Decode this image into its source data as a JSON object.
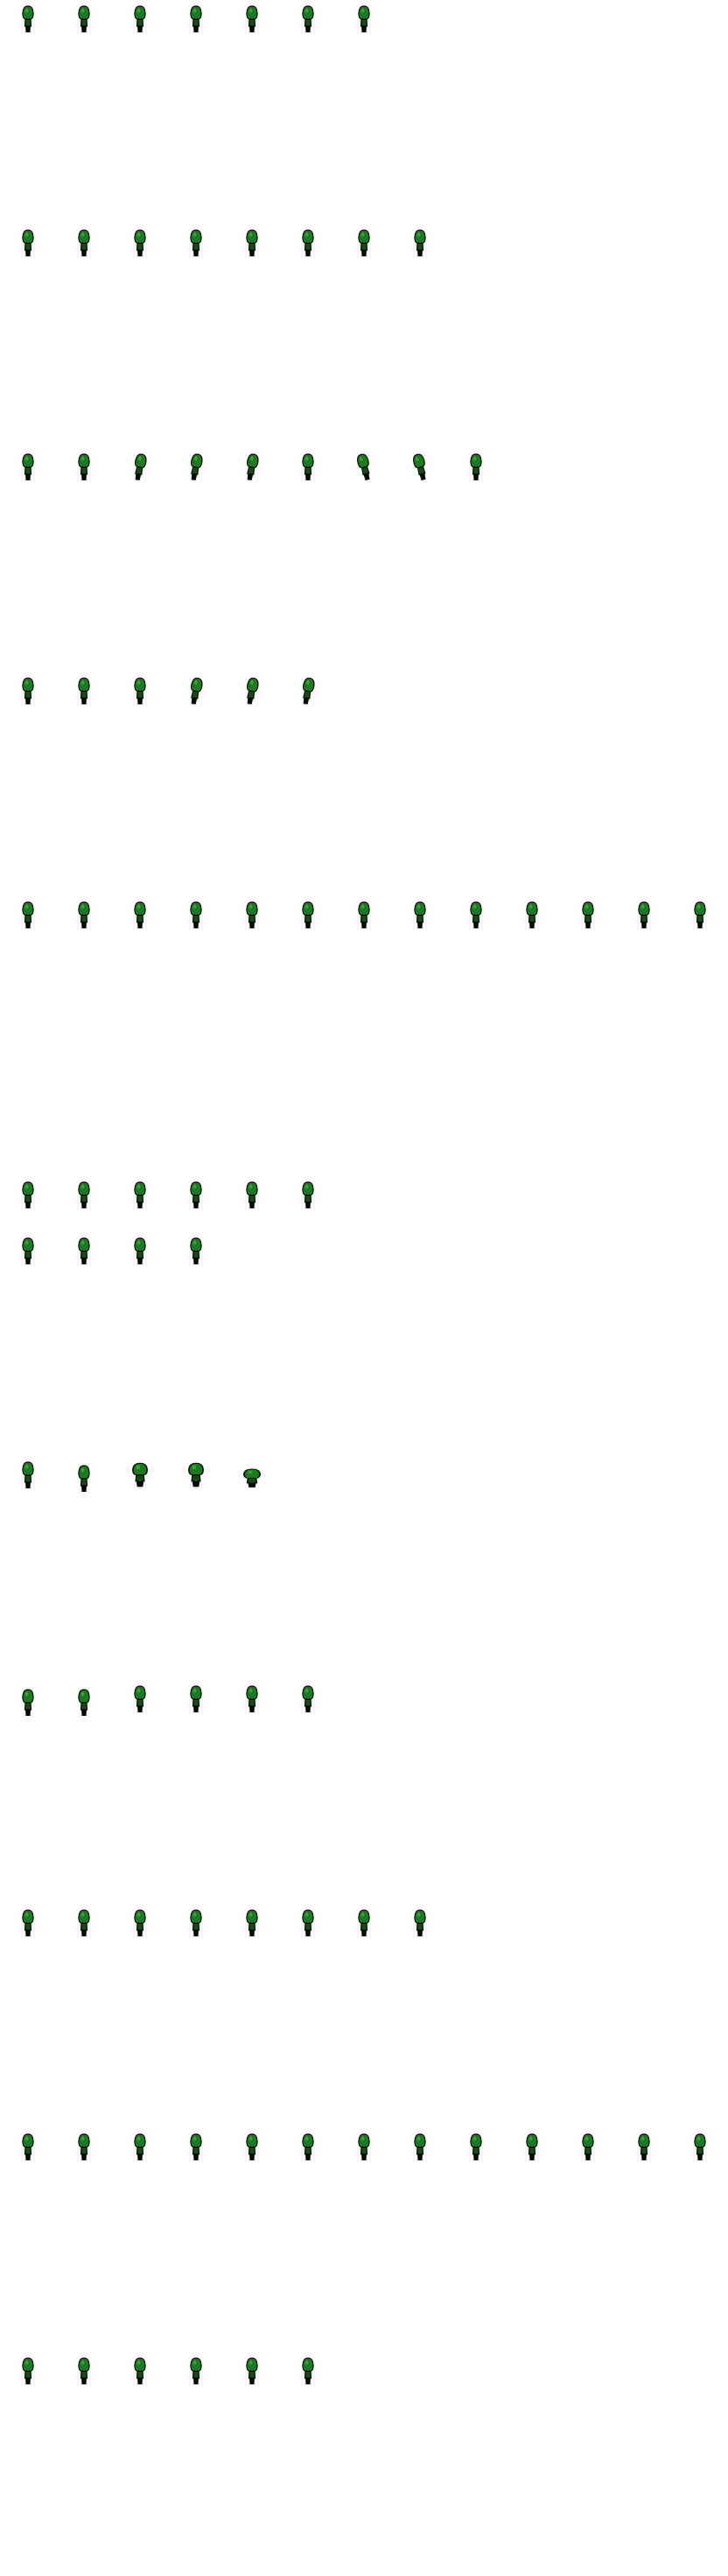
{
  "sprite_sheet": {
    "character": "green-hooded-figure",
    "colors": {
      "body": "#1f7a1f",
      "body_dark": "#134d13",
      "outline": "#0a0a0a",
      "background": "#ffffff"
    },
    "animations": [
      {
        "name": "row-1",
        "frames": 7,
        "poses": [
          "stand",
          "stand",
          "stand",
          "stand",
          "stand",
          "stand",
          "stand"
        ]
      },
      {
        "name": "row-2",
        "frames": 8,
        "poses": [
          "stand",
          "stand",
          "stand",
          "stand",
          "stand",
          "stand",
          "stand",
          "stand"
        ]
      },
      {
        "name": "row-3",
        "frames": 9,
        "poses": [
          "stand",
          "stand",
          "lean",
          "lean",
          "lean",
          "stand",
          "lean-right",
          "lean-right",
          "stand"
        ]
      },
      {
        "name": "row-4",
        "frames": 6,
        "poses": [
          "stand",
          "stand",
          "stand",
          "lean",
          "lean",
          "lean"
        ]
      },
      {
        "name": "row-5",
        "frames": 13,
        "poses": [
          "stand",
          "stand",
          "stand",
          "stand",
          "stand",
          "stand",
          "stand",
          "stand",
          "stand",
          "stand",
          "stand",
          "stand",
          "stand"
        ]
      },
      {
        "name": "row-6",
        "frames": 10,
        "poses": [
          "stand",
          "stand",
          "stand",
          "stand",
          "stand",
          "stand",
          "stand",
          "stand",
          "stand",
          "stand"
        ],
        "wraps_after": 6
      },
      {
        "name": "row-7",
        "frames": 5,
        "poses": [
          "stand",
          "low",
          "crouch",
          "crouch",
          "collapse"
        ]
      },
      {
        "name": "row-8",
        "frames": 6,
        "poses": [
          "low",
          "low",
          "stand",
          "stand",
          "stand",
          "stand"
        ]
      },
      {
        "name": "row-9",
        "frames": 8,
        "poses": [
          "stand",
          "stand",
          "stand",
          "stand",
          "stand",
          "stand",
          "stand",
          "stand"
        ]
      },
      {
        "name": "row-10",
        "frames": 13,
        "poses": [
          "stand",
          "stand",
          "stand",
          "stand",
          "stand",
          "stand",
          "stand",
          "stand",
          "stand",
          "stand",
          "stand",
          "stand",
          "stand"
        ]
      },
      {
        "name": "row-11",
        "frames": 6,
        "poses": [
          "stand",
          "stand",
          "stand",
          "stand",
          "stand",
          "stand"
        ]
      }
    ]
  }
}
